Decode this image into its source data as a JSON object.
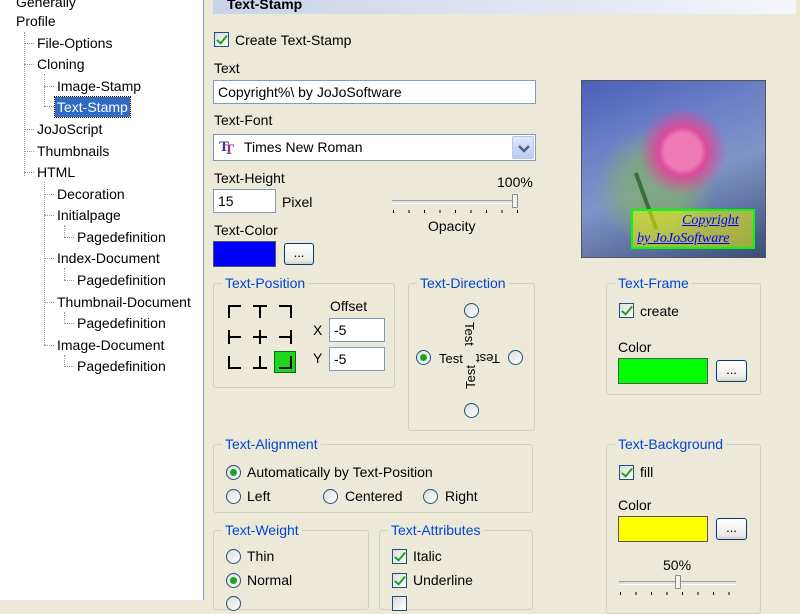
{
  "tree": {
    "items": [
      {
        "label": "Generally"
      },
      {
        "label": "Profile"
      },
      {
        "label": "File-Options"
      },
      {
        "label": "Cloning"
      },
      {
        "label": "Image-Stamp"
      },
      {
        "label": "Text-Stamp"
      },
      {
        "label": "JoJoScript"
      },
      {
        "label": "Thumbnails"
      },
      {
        "label": "HTML"
      },
      {
        "label": "Decoration"
      },
      {
        "label": "Initialpage"
      },
      {
        "label": "Pagedefinition"
      },
      {
        "label": "Index-Document"
      },
      {
        "label": "Pagedefinition"
      },
      {
        "label": "Thumbnail-Document"
      },
      {
        "label": "Pagedefinition"
      },
      {
        "label": "Image-Document"
      },
      {
        "label": "Pagedefinition"
      }
    ],
    "selected": "Text-Stamp"
  },
  "header": {
    "title": "Text-Stamp"
  },
  "stamp": {
    "create_label": "Create Text-Stamp",
    "create_checked": true,
    "text_label": "Text",
    "text_value": "Copyright%\\ by JoJoSoftware",
    "font_label": "Text-Font",
    "font_value": "Times New Roman",
    "height_label": "Text-Height",
    "height_value": "15",
    "height_unit": "Pixel",
    "opacity_percent": "100%",
    "opacity_label": "Opacity",
    "opacity_value": 1.0,
    "color_label": "Text-Color",
    "color_value": "#0000ff",
    "browse": "..."
  },
  "preview": {
    "line1": "Copyright",
    "line2": "by JoJoSoftware"
  },
  "position": {
    "title": "Text-Position",
    "offset_label": "Offset",
    "x_label": "X",
    "x_value": "-5",
    "y_label": "Y",
    "y_value": "-5",
    "selected_cell": "bottom-right"
  },
  "direction": {
    "title": "Text-Direction",
    "sample": "Test",
    "selected": "left-to-right"
  },
  "frame": {
    "title": "Text-Frame",
    "create_label": "create",
    "create_checked": true,
    "color_label": "Color",
    "color_value": "#00ff00",
    "browse": "..."
  },
  "alignment": {
    "title": "Text-Alignment",
    "auto_label": "Automatically by Text-Position",
    "left_label": "Left",
    "centered_label": "Centered",
    "right_label": "Right",
    "selected": "auto"
  },
  "background": {
    "title": "Text-Background",
    "fill_label": "fill",
    "fill_checked": true,
    "color_label": "Color",
    "color_value": "#ffff00",
    "browse": "...",
    "percent": "50%",
    "level": 0.5
  },
  "weight": {
    "title": "Text-Weight",
    "thin_label": "Thin",
    "normal_label": "Normal",
    "selected": "normal"
  },
  "attributes": {
    "title": "Text-Attributes",
    "italic_label": "Italic",
    "italic_checked": true,
    "underline_label": "Underline",
    "underline_checked": true
  }
}
